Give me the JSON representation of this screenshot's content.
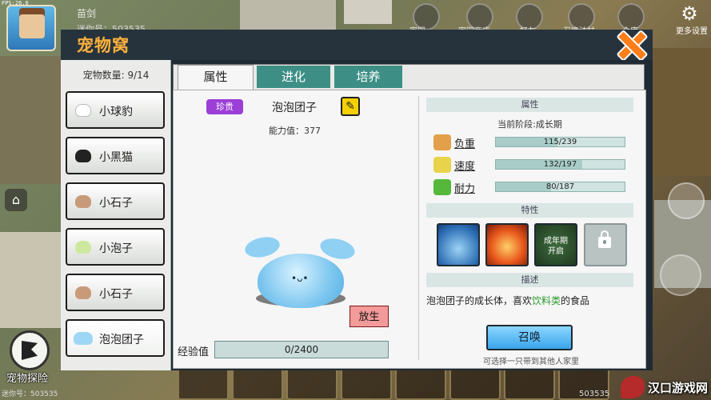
{
  "hud": {
    "fps": "FPS:26.6",
    "player_name": "苗剑",
    "player_id": "迷你号：503535",
    "top_labels": [
      "家园",
      "家园商店",
      "好友",
      "召唤法杖",
      "仓库"
    ],
    "more_settings": "更多设置",
    "explore_label": "宠物探险",
    "bottom_id_left": "迷你号：503535",
    "bottom_id_right": "503535",
    "watermark_text": "汉口游戏网"
  },
  "dialog": {
    "title": "宠物窝",
    "sidebar": {
      "pet_count": "宠物数量: 9/14",
      "pets": [
        {
          "label": "小球豹",
          "icon": "cloud-pet-icon"
        },
        {
          "label": "小黑猫",
          "icon": "black-cat-icon"
        },
        {
          "label": "小石子",
          "icon": "pig-pet-icon"
        },
        {
          "label": "小泡子",
          "icon": "green-pet-icon"
        },
        {
          "label": "小石子",
          "icon": "pig-pet-icon"
        },
        {
          "label": "泡泡团子",
          "icon": "bubble-pet-icon"
        }
      ]
    },
    "tabs": [
      "属性",
      "进化",
      "培养"
    ],
    "pet": {
      "rarity": "珍贵",
      "name": "泡泡团子",
      "power": "能力值：377",
      "release_label": "放生",
      "exp_label": "经验值",
      "exp_text": "0/2400",
      "exp_current": 0,
      "exp_max": 2400
    },
    "attributes": {
      "header": "属性",
      "stage": "当前阶段:成长期",
      "stats": [
        {
          "label": "负重",
          "text": "115/239",
          "value": 115,
          "max": 239,
          "icon": "weight-bag-icon",
          "color": "#e3a04a"
        },
        {
          "label": "速度",
          "text": "132/197",
          "value": 132,
          "max": 197,
          "icon": "speed-star-icon",
          "color": "#e8d34a"
        },
        {
          "label": "耐力",
          "text": "80/187",
          "value": 80,
          "max": 187,
          "icon": "stamina-arm-icon",
          "color": "#55b83a"
        }
      ]
    },
    "traits": {
      "header": "特性",
      "locked_trait_text": "成年期\n开启"
    },
    "description": {
      "header": "描述",
      "text_before": "泡泡团子的成长体，喜欢",
      "highlight": "饮料类",
      "text_after": "的食品"
    },
    "summon": {
      "label": "召唤",
      "hint": "可选择一只带到其他人家里"
    }
  }
}
